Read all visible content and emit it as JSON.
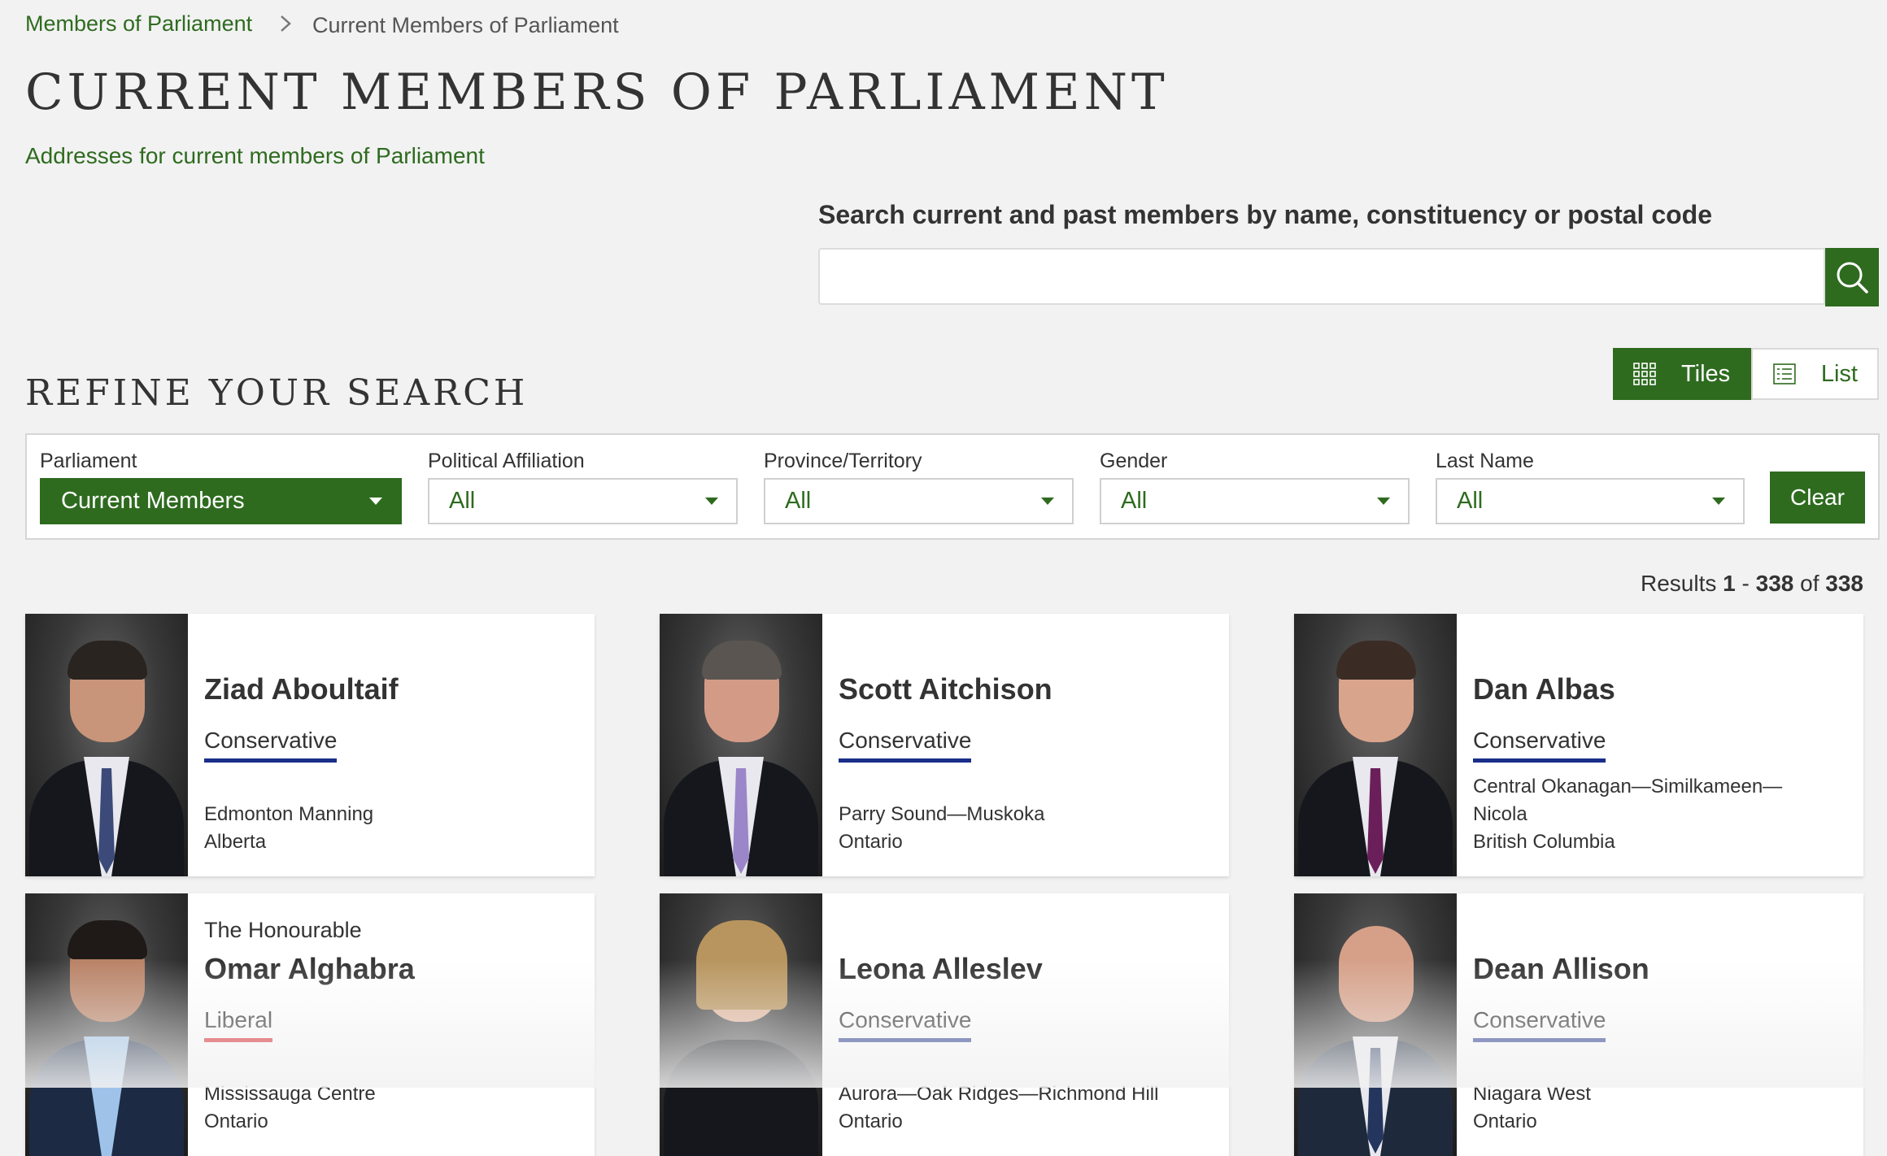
{
  "breadcrumb": {
    "parent": "Members of Parliament",
    "current": "Current Members of Parliament"
  },
  "page_title": "CURRENT MEMBERS OF PARLIAMENT",
  "address_link": "Addresses for current members of Parliament",
  "search": {
    "label": "Search current and past members by name, constituency or postal code",
    "value": "",
    "placeholder": ""
  },
  "view_toggle": {
    "tiles": "Tiles",
    "list": "List",
    "active": "tiles"
  },
  "refine_heading": "REFINE YOUR SEARCH",
  "filters": {
    "parliament": {
      "label": "Parliament",
      "value": "Current Members"
    },
    "affiliation": {
      "label": "Political Affiliation",
      "value": "All"
    },
    "province": {
      "label": "Province/Territory",
      "value": "All"
    },
    "gender": {
      "label": "Gender",
      "value": "All"
    },
    "last_name": {
      "label": "Last Name",
      "value": "All"
    },
    "clear": "Clear"
  },
  "results": {
    "prefix": "Results",
    "from": "1",
    "to": "338",
    "of_word": "of",
    "total": "338"
  },
  "colors": {
    "accent": "#2e6b1f",
    "conservative": "#1a2f8a",
    "liberal": "#d71920"
  },
  "members": [
    {
      "honorific": "",
      "name": "Ziad Aboultaif",
      "party": "Conservative",
      "riding": "Edmonton Manning",
      "province": "Alberta",
      "party_color": "#1a2f8a"
    },
    {
      "honorific": "",
      "name": "Scott Aitchison",
      "party": "Conservative",
      "riding": "Parry Sound—Muskoka",
      "province": "Ontario",
      "party_color": "#1a2f8a"
    },
    {
      "honorific": "",
      "name": "Dan Albas",
      "party": "Conservative",
      "riding": "Central Okanagan—Similkameen—Nicola",
      "province": "British Columbia",
      "party_color": "#1a2f8a"
    },
    {
      "honorific": "The Honourable",
      "name": "Omar Alghabra",
      "party": "Liberal",
      "riding": "Mississauga Centre",
      "province": "Ontario",
      "party_color": "#d71920"
    },
    {
      "honorific": "",
      "name": "Leona Alleslev",
      "party": "Conservative",
      "riding": "Aurora—Oak Ridges—Richmond Hill",
      "province": "Ontario",
      "party_color": "#1a2f8a"
    },
    {
      "honorific": "",
      "name": "Dean Allison",
      "party": "Conservative",
      "riding": "Niagara West",
      "province": "Ontario",
      "party_color": "#1a2f8a"
    }
  ]
}
